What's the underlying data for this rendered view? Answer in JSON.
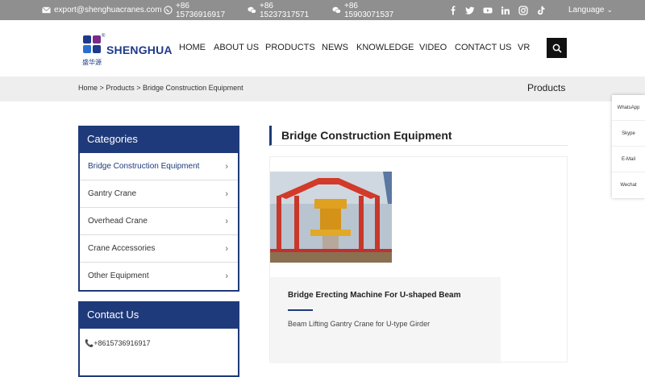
{
  "topbar": {
    "email": "export@shenghuacranes.com",
    "whatsapp_phone": [
      "+86",
      "15736916917"
    ],
    "wechat1_phone": [
      "+86",
      "15237317571"
    ],
    "wechat2_phone": [
      "+86",
      "15903071537"
    ],
    "social_icons": [
      "facebook-icon",
      "twitter-icon",
      "youtube-icon",
      "linkedin-icon",
      "instagram-icon",
      "tiktok-icon"
    ],
    "language": "Language"
  },
  "header": {
    "logo_text": "SHENGHUA",
    "logo_sub": "盛华源",
    "logo_reg": "®",
    "nav": [
      "HOME",
      "ABOUT US",
      "PRODUCTS",
      "NEWS",
      "KNOWLEDGE",
      "VIDEO",
      "CONTACT US",
      "VR"
    ]
  },
  "breadcrumb": {
    "path": "Home > Products > Bridge Construction Equipment",
    "section_title": "Products"
  },
  "sidebar": {
    "categories_title": "Categories",
    "categories": [
      "Bridge Construction Equipment",
      "Gantry Crane",
      "Overhead Crane",
      "Crane Accessories",
      "Other Equipment"
    ],
    "active_category": "Bridge Construction Equipment",
    "contact_title": "Contact Us",
    "contact_phone": "+8615736916917"
  },
  "main": {
    "title": "Bridge Construction Equipment",
    "product": {
      "name": "Bridge Erecting Machine For U-shaped Beam",
      "description": "Beam Lifting Gantry Crane for U-type Girder"
    }
  },
  "float_bar": [
    "WhatsApp",
    "Skype",
    "E-Mail",
    "Wechat"
  ],
  "colors": {
    "topbar_bg": "#8f8f8f",
    "brand_blue": "#1f3a7a",
    "crumb_bg": "#eeeeee"
  }
}
